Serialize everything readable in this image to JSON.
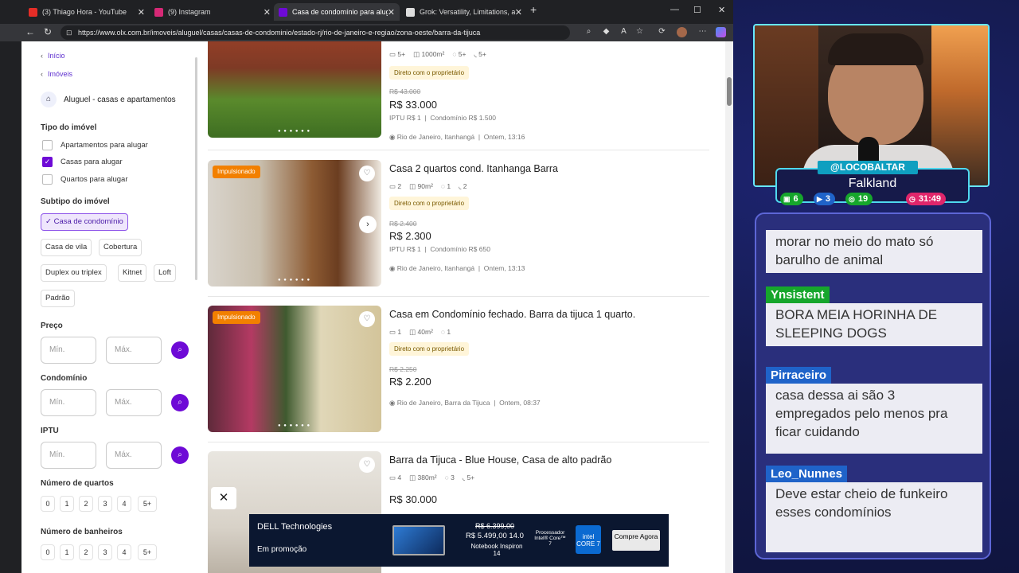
{
  "browser": {
    "tabs": [
      {
        "title": "(3) Thiago Hora - YouTube",
        "fav_color": "#e52d27"
      },
      {
        "title": "(9) Instagram",
        "fav_color": "#d62976"
      },
      {
        "title": "Casa de condomínio para alugar",
        "fav_color": "#6e0ad6"
      },
      {
        "title": "Grok: Versatility, Limitations, and",
        "fav_color": "#dddddd"
      }
    ],
    "url": "https://www.olx.com.br/imoveis/aluguel/casas/casas-de-condominio/estado-rj/rio-de-janeiro-e-regiao/zona-oeste/barra-da-tijuca"
  },
  "sidebar": {
    "crumb_home": "Início",
    "crumb_imoveis": "Imóveis",
    "category": "Aluguel - casas e apartamentos",
    "tipo_title": "Tipo do imóvel",
    "tipo": [
      "Apartamentos para alugar",
      "Casas para alugar",
      "Quartos para alugar"
    ],
    "subtipo_title": "Subtipo do imóvel",
    "subtipo": [
      "Casa de condomínio",
      "Casa de vila",
      "Cobertura",
      "Duplex ou triplex",
      "Kitnet",
      "Loft",
      "Padrão"
    ],
    "preco_title": "Preço",
    "condominio_title": "Condomínio",
    "iptu_title": "IPTU",
    "min_placeholder": "Mín.",
    "max_placeholder": "Máx.",
    "quartos_title": "Número de quartos",
    "banheiros_title": "Número de banheiros",
    "numbers": [
      "0",
      "1",
      "2",
      "3",
      "4",
      "5+"
    ]
  },
  "listings": [
    {
      "title": "",
      "beds": "5+",
      "area": "1000m²",
      "garage": "5+",
      "baths": "5+",
      "owner": "Direto com o proprietário",
      "old_price": "R$ 43.000",
      "price": "R$ 33.000",
      "iptu": "IPTU R$ 1",
      "condo": "Condomínio R$ 1.500",
      "location": "Rio de Janeiro, Itanhangá",
      "date": "Ontem, 13:16"
    },
    {
      "badge": "Impulsionado",
      "title": "Casa 2 quartos cond. Itanhanga Barra",
      "beds": "2",
      "area": "90m²",
      "garage": "1",
      "baths": "2",
      "owner": "Direto com o proprietário",
      "old_price": "R$ 2.400",
      "price": "R$ 2.300",
      "iptu": "IPTU R$ 1",
      "condo": "Condomínio R$ 650",
      "location": "Rio de Janeiro, Itanhangá",
      "date": "Ontem, 13:13"
    },
    {
      "badge": "Impulsionado",
      "title": "Casa em Condomínio fechado. Barra da tijuca 1 quarto.",
      "beds": "1",
      "area": "40m²",
      "garage": "1",
      "owner": "Direto com o proprietário",
      "old_price": "R$ 2.250",
      "price": "R$ 2.200",
      "location": "Rio de Janeiro, Barra da Tijuca",
      "date": "Ontem, 08:37"
    },
    {
      "title": "Barra da Tijuca - Blue House, Casa de alto padrão",
      "beds": "4",
      "area": "380m²",
      "garage": "3",
      "baths": "5+",
      "price": "R$ 30.000"
    }
  ],
  "ad": {
    "brand": "DELL Technologies",
    "promo": "Em promoção",
    "old_price": "R$ 6.399,00",
    "new_price": "R$ 5.499,00 14.0",
    "product": "Notebook Inspiron 14",
    "processor": "Processador Intel® Core™ 7",
    "intel": "intel CORE 7",
    "cta": "Compre Agora"
  },
  "stream": {
    "handle": "@LOCOBALTAR",
    "city": "Falkland",
    "stats": [
      "6",
      "3",
      "19",
      "31:49"
    ]
  },
  "chat": [
    {
      "name": "",
      "text": "morar no meio do mato só barulho de animal",
      "color": ""
    },
    {
      "name": "Ynsistent",
      "text": "BORA MEIA HORINHA DE SLEEPING DOGS",
      "color": "#16a62c"
    },
    {
      "name": "Pirraceiro",
      "text": "casa dessa ai são 3 empregados pelo menos pra ficar cuidando",
      "color": "#1f63c9"
    },
    {
      "name": "Leo_Nunnes",
      "text": "Deve estar cheio de funkeiro esses condomínios",
      "color": "#1f63c9"
    }
  ]
}
